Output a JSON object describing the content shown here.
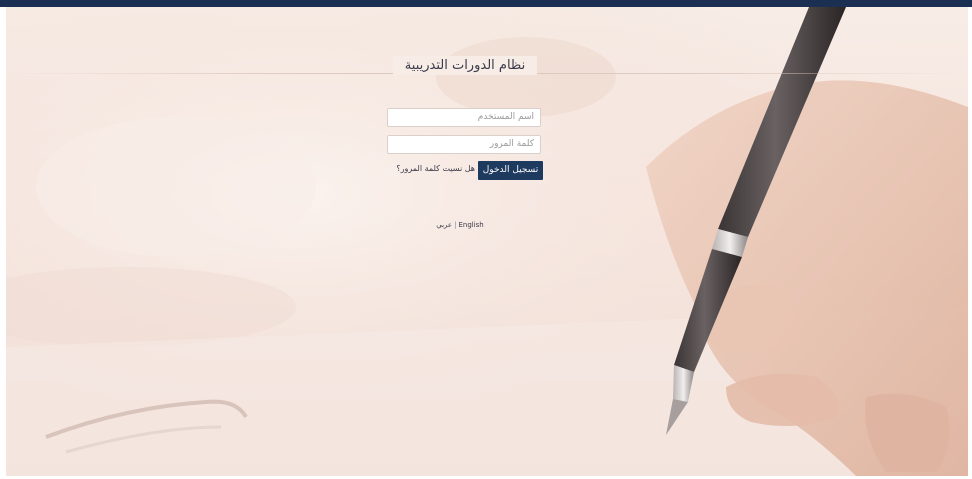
{
  "header": {
    "title": "نظام الدورات التدريبية"
  },
  "login_form": {
    "username_placeholder": "اسم المستخدم",
    "password_placeholder": "كلمة المرور",
    "login_button_label": "تسجيل الدخول",
    "forgot_password_label": "هل نسيت كلمة المرور؟"
  },
  "language_switch": {
    "english_label": "English",
    "separator": "|",
    "arabic_label": "عربي"
  },
  "colors": {
    "top_bar": "#1b2f52",
    "button": "#1e3a5f",
    "background": "#f6e6df"
  },
  "background_image": {
    "icon": "hand-writing-with-pen-photo"
  }
}
